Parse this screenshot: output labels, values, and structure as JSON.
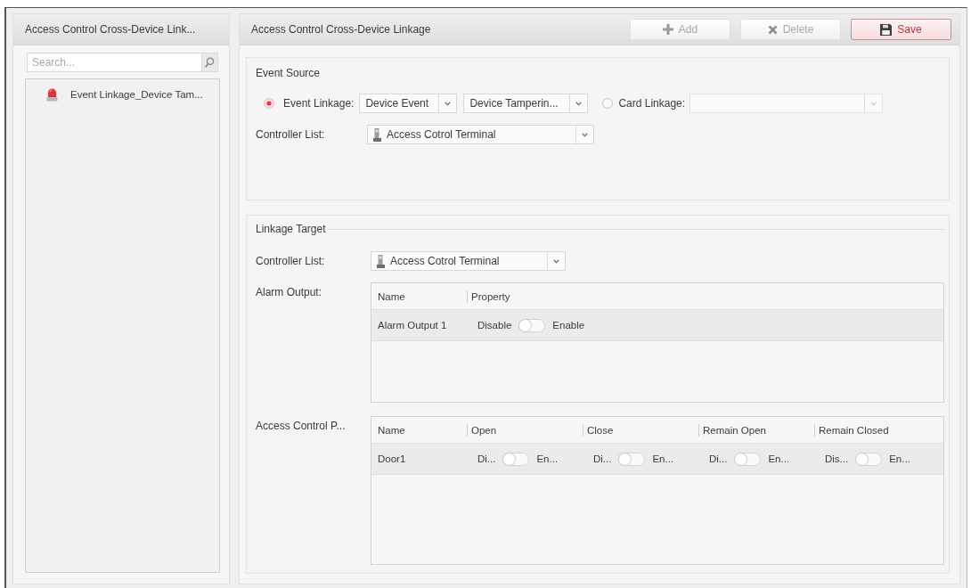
{
  "sidebar": {
    "title": "Access Control Cross-Device Link...",
    "search": {
      "placeholder": "Search..."
    },
    "tree": [
      {
        "label": "Event Linkage_Device Tam...",
        "selected": false
      }
    ]
  },
  "panel": {
    "title": "Access Control Cross-Device Linkage",
    "buttons": [
      {
        "kind": "add",
        "label": "Add",
        "disabled": true
      },
      {
        "kind": "delete",
        "label": "Delete",
        "disabled": true
      },
      {
        "kind": "save",
        "label": "Save",
        "disabled": false
      }
    ]
  },
  "event_source": {
    "title": "Event Source",
    "sources": [
      {
        "label": "Event Linkage:",
        "selected": true,
        "dropdowns": [
          {
            "value": "Device Event",
            "disabled": false
          },
          {
            "value": "Device Tamperin...",
            "disabled": false
          }
        ]
      },
      {
        "label": "Card Linkage:",
        "selected": false,
        "dropdowns": [
          {
            "disabled": true
          }
        ]
      }
    ],
    "controller_list": {
      "label": "Controller List:",
      "value": "Access Cotrol Terminal"
    }
  },
  "linkage_target": {
    "title": "Linkage Target",
    "controller_list": {
      "label": "Controller List:",
      "value": "Access Cotrol Terminal"
    },
    "tables": [
      {
        "label": "Alarm Output:",
        "columns": [
          "Name",
          "Property"
        ],
        "rows": [
          {
            "name": "Alarm Output 1",
            "selected": true,
            "toggles": [
              {
                "off_label": "Disable",
                "on_label": "Enable",
                "on": false
              }
            ]
          }
        ]
      },
      {
        "label": "Access Control P...",
        "columns": [
          "Name",
          "Open",
          "Close",
          "Remain Open",
          "Remain Closed"
        ],
        "rows": [
          {
            "name": "Door1",
            "selected": true,
            "toggles": [
              {
                "off_label": "Di...",
                "on_label": "En...",
                "on": false
              },
              {
                "off_label": "Di...",
                "on_label": "En...",
                "on": false
              },
              {
                "off_label": "Di...",
                "on_label": "En...",
                "on": false
              },
              {
                "off_label": "Dis...",
                "on_label": "En...",
                "on": false
              }
            ]
          }
        ]
      }
    ]
  }
}
